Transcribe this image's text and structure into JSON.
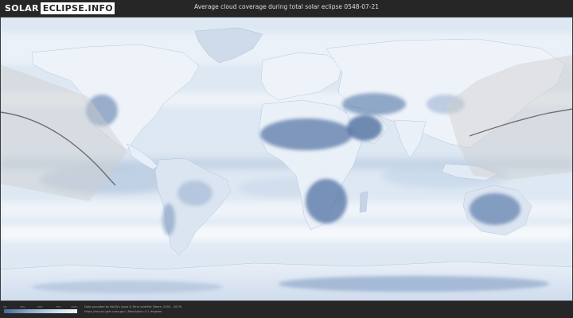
{
  "header": {
    "logo_part1": "SOLAR",
    "logo_part2": "ECLIPSE.INFO",
    "title": "Average cloud coverage during total solar eclipse 0548-07-21"
  },
  "map": {
    "kind": "world cloud-coverage map",
    "ocean_color": "#dde8f3",
    "land_cloudy_color": "#f2f6fb",
    "clear_sky_color": "#5b7aa8",
    "eclipse_path_color": "#555555",
    "shadow_overlay_color": "#cfcfcf"
  },
  "legend": {
    "ticks": [
      "0%",
      "25%",
      "50%",
      "75%",
      "100%"
    ],
    "low_color": "#4a6a9a",
    "high_color": "#f4f7fb"
  },
  "footer": {
    "credit_line1": "Data provided by NASA's Aqua & Terra satellite (Years: 2000 - 2019)",
    "credit_line2": "https://neo.sci.gsfc.nasa.gov | Resolution: 0.1 degrees"
  }
}
